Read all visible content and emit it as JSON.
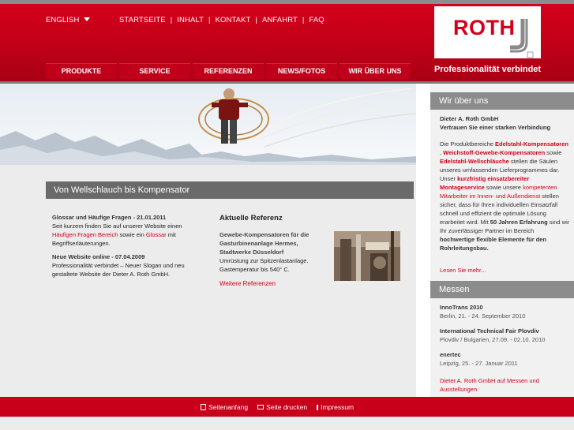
{
  "header": {
    "language": "ENGLISH",
    "top_links": [
      "STARTSEITE",
      "INHALT",
      "KONTAKT",
      "ANFAHRT",
      "FAQ"
    ],
    "logo_text": "ROTH",
    "slogan": "Professionalität verbindet",
    "brand_color": "#d4001b"
  },
  "main_nav": [
    "PRODUKTE",
    "SERVICE",
    "REFERENZEN",
    "NEWS/FOTOS",
    "WIR ÜBER UNS"
  ],
  "content": {
    "title": "Von Wellschlauch bis Kompensator",
    "news": [
      {
        "heading": "Glossar und Häufige Fragen - 21.01.2011",
        "text_a": "Seit kurzem finden Sie auf unserer Website einen ",
        "link_a": "Häufigen Fragen Bereich",
        "text_b": " sowie ein ",
        "link_b": "Glossar",
        "text_c": " mit Begriffserläuterungen."
      },
      {
        "heading": "Neue Website online - 07.04.2009",
        "text": "Professionalität verbindet – Neuer Slogan und neu gestaltete Website der Dieter A. Roth GmbH."
      }
    ],
    "reference": {
      "heading": "Aktuelle Referenz",
      "title": "Gewebe-Kompensatoren für die Gasturbinenanlage Hermes, Stadtwerke Düsseldorf",
      "text": "Umrüstung zur Spitzenlastanlage. Gastemperatur bis 540° C.",
      "link": "Weitere Referenzen"
    }
  },
  "sidebar": {
    "about": {
      "heading": "Wir über uns",
      "company": "Dieter A. Roth GmbH",
      "tagline": "Vertrauen Sie einer starken Verbindung",
      "p1": "Die Produktbereiche ",
      "l1": "Edelstahl-Kompensatoren",
      "p2": " , ",
      "l2": "Weichstoff-Gewebe-Kompensatoren",
      "p3": " sowie ",
      "l3": "Edelstahl-Wellschläuche",
      "p4": " stellen die Säulen unseres umfassenden Lieferprogrammes dar. Unser ",
      "l4": "kurzfristig einsatzbereiter Montageservice",
      "p5": " sowie unsere ",
      "l5": "kompetenten Mitarbeiter im Innen- und Außendienst",
      "p6": " stellen sicher, dass für Ihren individuellen Einsatzfall schnell und effizient die optimale Lösung erarbeitet wird. Mit ",
      "b1": "50 Jahren Erfahrung",
      "p7": " sind wir Ihr zuverlässiger Partner im Bereich ",
      "b2": "hochwertige flexible Elemente für den Rohrleitungsbau.",
      "more": "Lesen Sie mehr..."
    },
    "fairs": {
      "heading": "Messen",
      "events": [
        {
          "title": "InnoTrans 2010",
          "detail": "Berlin, 21. - 24. September 2010"
        },
        {
          "title": "International Technical Fair Plovdiv",
          "detail": "Plovdiv / Bulgarien, 27.09. - 02.10. 2010"
        },
        {
          "title": "enertec",
          "detail": "Leipzig, 25. - 27. Januar 2011"
        }
      ],
      "link": "Dieter A. Roth GmbH auf Messen und Ausstellungen"
    }
  },
  "footer": {
    "links": [
      "Seitenanfang",
      "Seite drucken",
      "Impressum"
    ]
  }
}
